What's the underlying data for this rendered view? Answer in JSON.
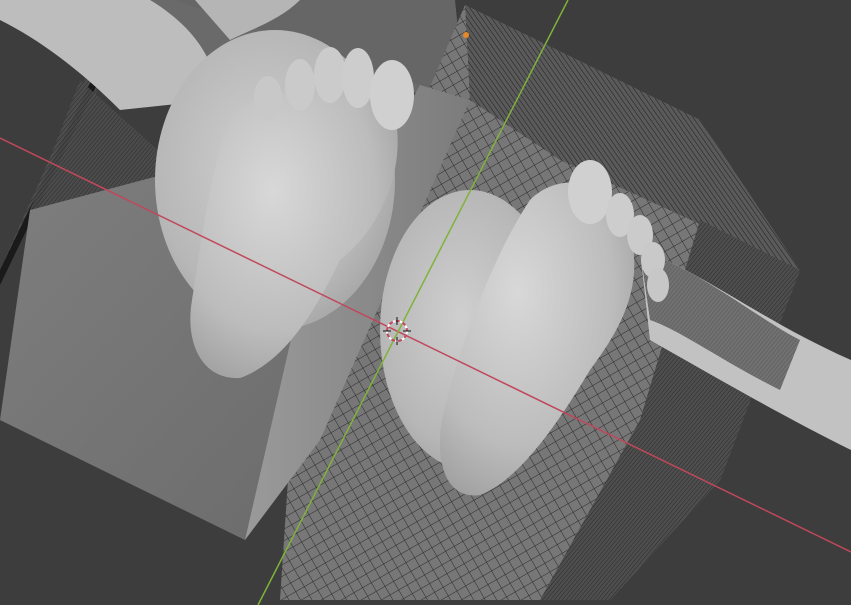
{
  "viewport": {
    "background_color": "#3d3d3d",
    "x_axis_color": "#c0485a",
    "y_axis_color": "#7fb33a",
    "origin_color": "#e6882a",
    "wire_color": "#1f1f1f",
    "box_face_color": "#7a7a7a",
    "mesh_color": "#b9b9b9"
  },
  "icons": {
    "cursor": "3d-cursor-icon",
    "origin": "object-origin-icon"
  }
}
